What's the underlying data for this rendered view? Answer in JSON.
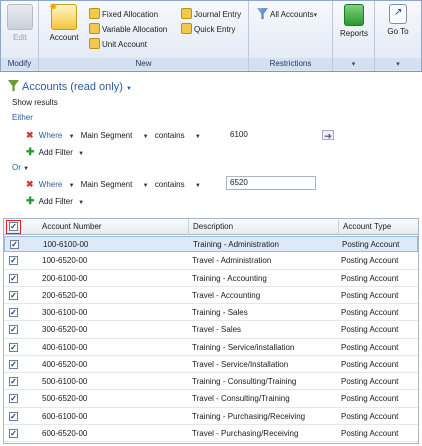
{
  "ribbon": {
    "modify": {
      "group_label": "Modify",
      "edit_label": "Edit"
    },
    "new": {
      "group_label": "New",
      "account_label": "Account",
      "fixed_allocation": "Fixed Allocation",
      "variable_allocation": "Variable Allocation",
      "unit_account": "Unit Account",
      "journal_entry": "Journal Entry",
      "quick_entry": "Quick Entry"
    },
    "restrictions": {
      "group_label": "Restrictions",
      "all_accounts": "All Accounts"
    },
    "reports": {
      "label": "Reports"
    },
    "goto": {
      "label": "Go To"
    }
  },
  "filter": {
    "title": "Accounts (read only)",
    "show_results": "Show results",
    "either": "Either",
    "or": "Or",
    "where": "Where",
    "add_filter": "Add Filter",
    "row1": {
      "field": "Main Segment",
      "op": "contains",
      "value": "6100"
    },
    "row2": {
      "field": "Main Segment",
      "op": "contains",
      "value": "6520"
    }
  },
  "grid": {
    "columns": [
      "Account Number",
      "Description",
      "Account Type"
    ],
    "rows": [
      {
        "number": "100-6100-00",
        "description": "Training - Administration",
        "type": "Posting Account",
        "selected": true
      },
      {
        "number": "100-6520-00",
        "description": "Travel - Administration",
        "type": "Posting Account"
      },
      {
        "number": "200-6100-00",
        "description": "Training - Accounting",
        "type": "Posting Account"
      },
      {
        "number": "200-6520-00",
        "description": "Travel - Accounting",
        "type": "Posting Account"
      },
      {
        "number": "300-6100-00",
        "description": "Training - Sales",
        "type": "Posting Account"
      },
      {
        "number": "300-6520-00",
        "description": "Travel - Sales",
        "type": "Posting Account"
      },
      {
        "number": "400-6100-00",
        "description": "Training - Service/installation",
        "type": "Posting Account"
      },
      {
        "number": "400-6520-00",
        "description": "Travel - Service/Installation",
        "type": "Posting Account"
      },
      {
        "number": "500-6100-00",
        "description": "Training - Consulting/Training",
        "type": "Posting Account"
      },
      {
        "number": "500-6520-00",
        "description": "Travel - Consulting/Training",
        "type": "Posting Account"
      },
      {
        "number": "600-6100-00",
        "description": "Training - Purchasing/Receiving",
        "type": "Posting Account"
      },
      {
        "number": "600-6520-00",
        "description": "Travel - Purchasing/Receiving",
        "type": "Posting Account"
      }
    ]
  },
  "colors": {
    "accent": "#2a5d9f",
    "selected_row": "#dce9f7",
    "header_check_border": "#dd2222"
  }
}
